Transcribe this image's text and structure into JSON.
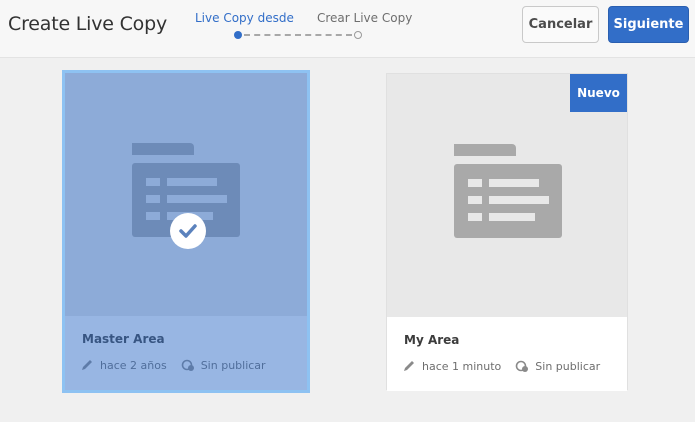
{
  "header": {
    "title": "Create Live Copy",
    "steps": [
      {
        "label": "Live Copy desde",
        "state": "active"
      },
      {
        "label": "Crear Live Copy",
        "state": "pending"
      }
    ],
    "cancel_label": "Cancelar",
    "next_label": "Siguiente"
  },
  "colors": {
    "accent": "#326ec8",
    "selection_outline": "#8ec2f2"
  },
  "cards": [
    {
      "name": "Master Area",
      "modified": "hace 2 años",
      "status": "Sin publicar",
      "selected": true,
      "thumbnail_icon": "folder-icon"
    },
    {
      "name": "My Area",
      "modified": "hace 1 minuto",
      "status": "Sin publicar",
      "selected": false,
      "badge": "Nuevo",
      "thumbnail_icon": "folder-icon"
    }
  ]
}
